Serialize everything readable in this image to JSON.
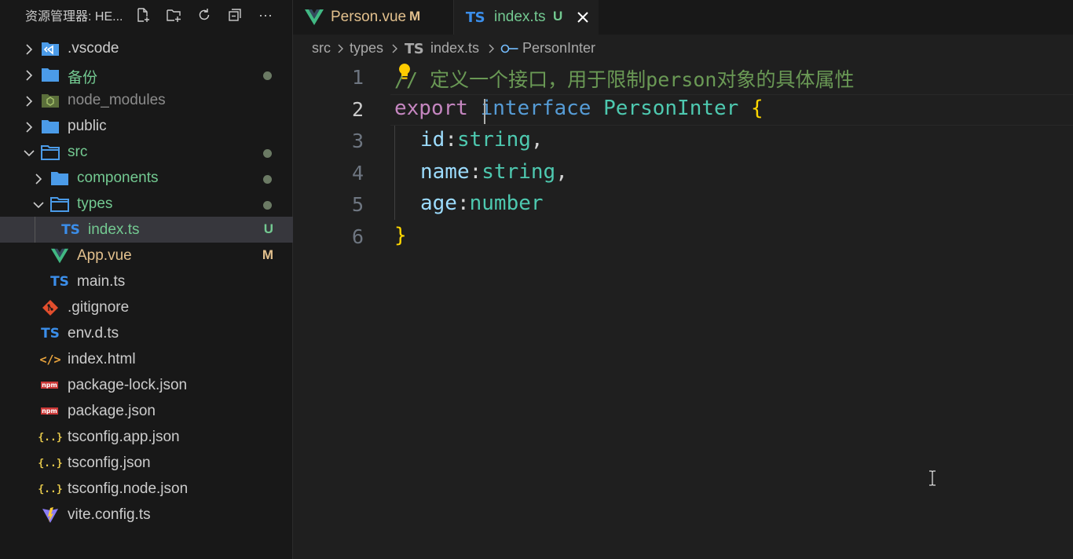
{
  "sidebar": {
    "title": "资源管理器: HE...",
    "actions": [
      "new-file-icon",
      "new-folder-icon",
      "refresh-icon",
      "collapse-all-icon",
      "more-icon"
    ],
    "more_label": "···"
  },
  "tree": [
    {
      "label": ".vscode",
      "kind": "folder-vscode",
      "expandable": true,
      "expanded": false,
      "depth": 0,
      "color": "#cccccc"
    },
    {
      "label": "备份",
      "kind": "folder",
      "expandable": true,
      "expanded": false,
      "depth": 0,
      "color": "#73c991",
      "dot": true
    },
    {
      "label": "node_modules",
      "kind": "folder-node",
      "expandable": true,
      "expanded": false,
      "depth": 0,
      "color": "#8c8c8c"
    },
    {
      "label": "public",
      "kind": "folder",
      "expandable": true,
      "expanded": false,
      "depth": 0,
      "color": "#cccccc"
    },
    {
      "label": "src",
      "kind": "folder-open",
      "expandable": true,
      "expanded": true,
      "depth": 0,
      "color": "#73c991",
      "dot": true
    },
    {
      "label": "components",
      "kind": "folder",
      "expandable": true,
      "expanded": false,
      "depth": 1,
      "color": "#73c991",
      "dot": true
    },
    {
      "label": "types",
      "kind": "folder-open",
      "expandable": true,
      "expanded": true,
      "depth": 1,
      "color": "#73c991",
      "dot": true
    },
    {
      "label": "index.ts",
      "kind": "ts",
      "expandable": false,
      "depth": 2,
      "color": "#73c991",
      "status": "U",
      "selected": true
    },
    {
      "label": "App.vue",
      "kind": "vue",
      "expandable": false,
      "depth": 1,
      "color": "#e2c08d",
      "status": "M"
    },
    {
      "label": "main.ts",
      "kind": "ts",
      "expandable": false,
      "depth": 1,
      "color": "#cccccc"
    },
    {
      "label": ".gitignore",
      "kind": "git",
      "expandable": false,
      "depth": 0,
      "color": "#cccccc"
    },
    {
      "label": "env.d.ts",
      "kind": "ts",
      "expandable": false,
      "depth": 0,
      "color": "#cccccc"
    },
    {
      "label": "index.html",
      "kind": "html",
      "expandable": false,
      "depth": 0,
      "color": "#cccccc"
    },
    {
      "label": "package-lock.json",
      "kind": "npm",
      "expandable": false,
      "depth": 0,
      "color": "#cccccc"
    },
    {
      "label": "package.json",
      "kind": "npm",
      "expandable": false,
      "depth": 0,
      "color": "#cccccc"
    },
    {
      "label": "tsconfig.app.json",
      "kind": "json",
      "expandable": false,
      "depth": 0,
      "color": "#cccccc"
    },
    {
      "label": "tsconfig.json",
      "kind": "json",
      "expandable": false,
      "depth": 0,
      "color": "#cccccc"
    },
    {
      "label": "tsconfig.node.json",
      "kind": "json",
      "expandable": false,
      "depth": 0,
      "color": "#cccccc"
    },
    {
      "label": "vite.config.ts",
      "kind": "vite",
      "expandable": false,
      "depth": 0,
      "color": "#cccccc"
    }
  ],
  "icon_text": {
    "ts": "TS",
    "html": "</>",
    "json": "{..}",
    "npm": "npm"
  },
  "tabs": [
    {
      "label": "Person.vue",
      "status": "M",
      "icon": "vue-icon",
      "active": false,
      "color": "#e2c08d"
    },
    {
      "label": "index.ts",
      "status": "U",
      "icon": "ts-icon",
      "active": true,
      "color": "#73c991"
    }
  ],
  "breadcrumb": {
    "parts": [
      "src",
      "types",
      "index.ts",
      "PersonInter"
    ],
    "ts_badge": "TS"
  },
  "editor": {
    "line_numbers": [
      "1",
      "2",
      "3",
      "4",
      "5",
      "6"
    ],
    "active_line": "2",
    "code": {
      "line1": "// 定义一个接口，用于限制person对象的具体属性",
      "l2_export": "export",
      "l2_interface": "interface",
      "l2_name": "PersonInter",
      "l2_brace": "{",
      "l3_prop": "id",
      "l3_type": "string",
      "l4_prop": "name",
      "l4_type": "string",
      "l5_prop": "age",
      "l5_type": "number",
      "l6_brace": "}",
      "colon": ":",
      "comma": ","
    }
  },
  "colors": {
    "accent": "#3b8eea",
    "git_untracked": "#73c991",
    "git_modified": "#e2c08d"
  }
}
